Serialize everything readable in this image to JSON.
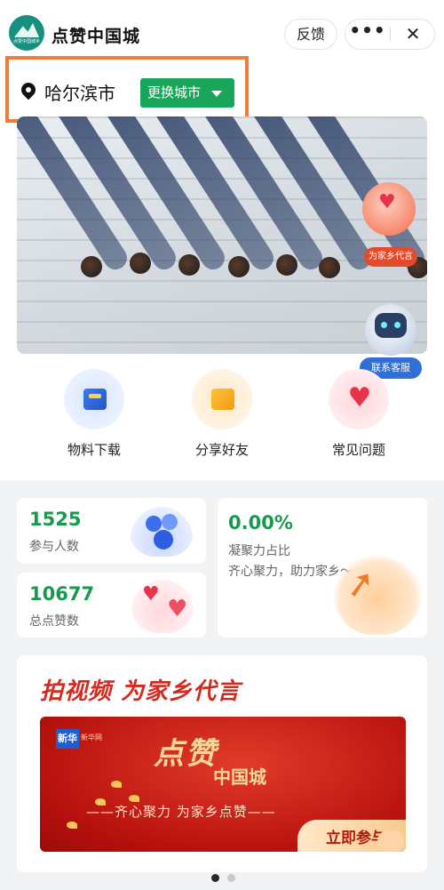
{
  "header": {
    "logo_text": "点赞中国城乡",
    "app_title": "点赞中国城",
    "feedback_label": "反馈",
    "more_label": "•••",
    "close_label": "✕"
  },
  "location": {
    "city": "哈尔滨市",
    "change_city_label": "更换城市"
  },
  "banner": {
    "badge_label": "为家乡代言",
    "service_label": "联系客服"
  },
  "actions": [
    {
      "label": "物料下载",
      "icon": "folder-download-icon"
    },
    {
      "label": "分享好友",
      "icon": "share-folder-icon"
    },
    {
      "label": "常见问题",
      "icon": "heart-icon"
    }
  ],
  "stats": {
    "participants_value": "1525",
    "participants_label": "参与人数",
    "likes_value": "10677",
    "likes_label": "总点赞数",
    "cohesion_value": "0.00%",
    "cohesion_label": "凝聚力占比",
    "slogan": "齐心聚力，助力家乡～"
  },
  "promo": {
    "title": "拍视频 为家乡代言",
    "publisher_logo": "新华",
    "publisher_sub": "新华网",
    "calligraphy_main": "点赞",
    "calligraphy_sub": "中国城",
    "tagline": "——齐心聚力 为家乡点赞——",
    "join_label": "立即参与"
  },
  "pager": {
    "current": 1,
    "total": 2
  },
  "colors": {
    "accent_green": "#1aa65a",
    "stat_green": "#179a4e",
    "highlight_orange": "#f07c3a",
    "promo_red": "#d42a1f"
  }
}
